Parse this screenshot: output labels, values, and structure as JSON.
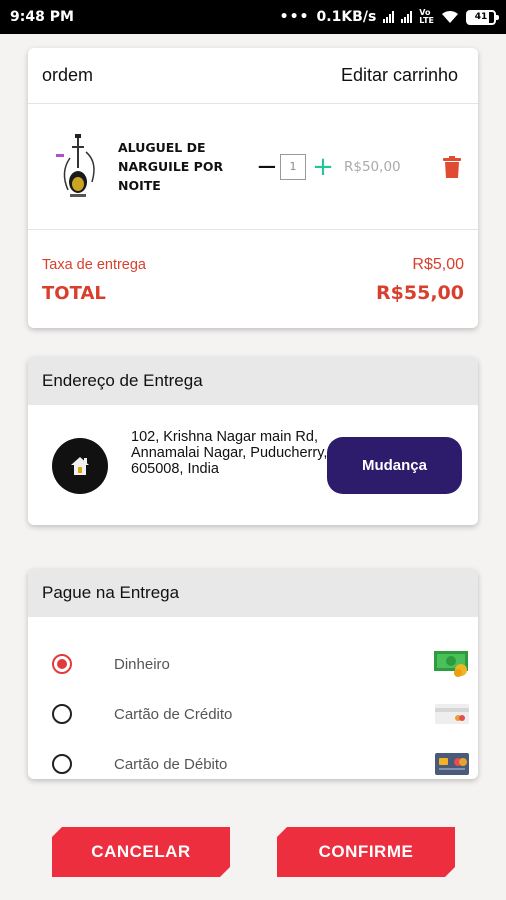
{
  "status_bar": {
    "time": "9:48 PM",
    "speed": "0.1KB/s",
    "battery": "41"
  },
  "order": {
    "title": "ordem",
    "edit_label": "Editar carrinho",
    "item": {
      "name": "ALUGUEL DE NARGUILE POR NOITE",
      "quantity": "1",
      "price": "R$50,00"
    },
    "delivery_fee_label": "Taxa de entrega",
    "delivery_fee_value": "R$5,00",
    "total_label": "TOTAL",
    "total_value": "R$55,00",
    "accent_color": "#d8402d"
  },
  "address": {
    "title": "Endereço de Entrega",
    "text": "102, Krishna Nagar main Rd, Annamalai Nagar, Puducherry, 605008, India",
    "change_label": "Mudança",
    "button_color": "#2c1c6b"
  },
  "payment": {
    "title": "Pague na Entrega",
    "options": [
      {
        "label": "Dinheiro",
        "selected": true,
        "icon": "cash-icon"
      },
      {
        "label": "Cartão de Crédito",
        "selected": false,
        "icon": "credit-card-icon"
      },
      {
        "label": "Cartão de Débito",
        "selected": false,
        "icon": "debit-card-icon"
      }
    ]
  },
  "actions": {
    "cancel_label": "CANCELAR",
    "confirm_label": "CONFIRME",
    "button_color": "#ed2e3f"
  }
}
